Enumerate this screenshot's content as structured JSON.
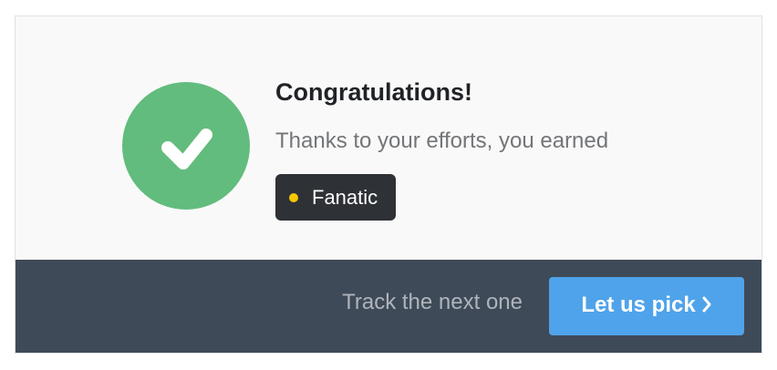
{
  "banner": {
    "title": "Congratulations!",
    "message": "Thanks to your efforts, you earned",
    "icon": "checkmark-icon",
    "badge": {
      "label": "Fanatic",
      "dot_color": "#f6c700"
    }
  },
  "footer": {
    "prompt": "Track the next one",
    "button_label": "Let us pick",
    "button_icon": "chevron-right-icon"
  },
  "colors": {
    "success": "#62bc7d",
    "footer_bg": "#3f4a58",
    "button_bg": "#4fa3ea",
    "badge_bg": "#2e3136"
  }
}
